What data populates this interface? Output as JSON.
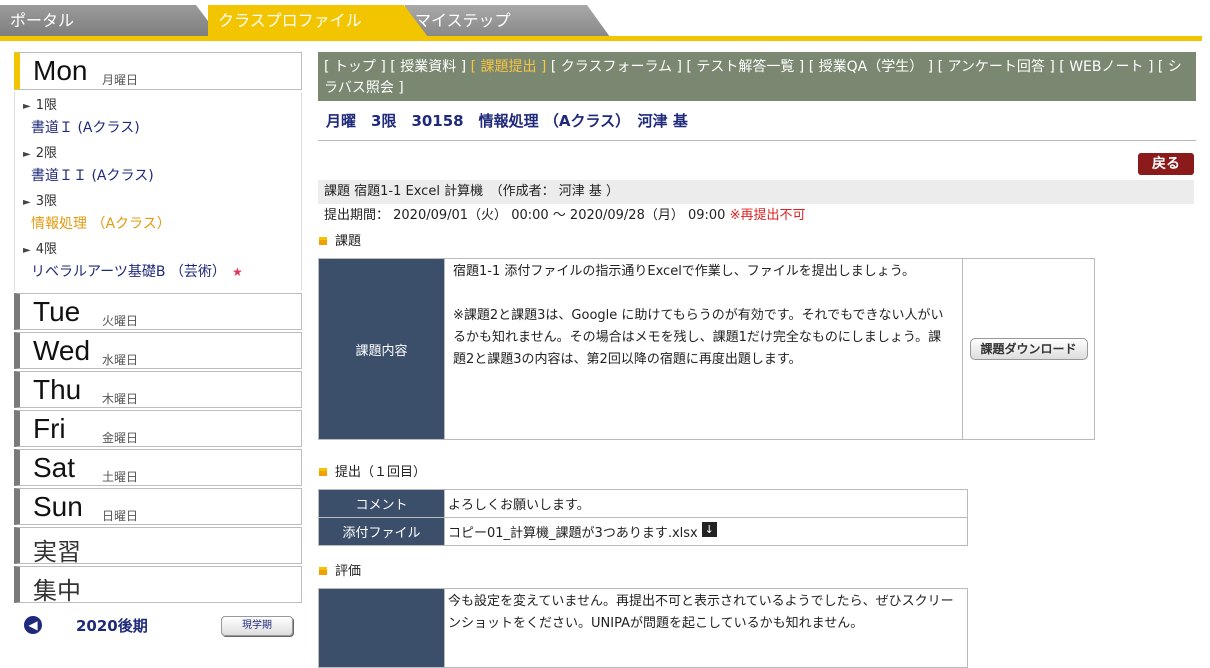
{
  "tabs": {
    "portal": "ポータル",
    "class_profile": "クラスプロファイル",
    "my_step": "マイステップ"
  },
  "sidebar": {
    "days": [
      {
        "en": "Mon",
        "jp": "月曜日"
      },
      {
        "en": "Tue",
        "jp": "火曜日"
      },
      {
        "en": "Wed",
        "jp": "水曜日"
      },
      {
        "en": "Thu",
        "jp": "木曜日"
      },
      {
        "en": "Fri",
        "jp": "金曜日"
      },
      {
        "en": "Sat",
        "jp": "土曜日"
      },
      {
        "en": "Sun",
        "jp": "日曜日"
      }
    ],
    "monday_periods": [
      {
        "period": "1限",
        "course": "書道Ｉ (Aクラス)"
      },
      {
        "period": "2限",
        "course": "書道ＩＩ (Aクラス)"
      },
      {
        "period": "3限",
        "course": "情報処理 （Aクラス）"
      },
      {
        "period": "4限",
        "course": "リベラルアーツ基礎B （芸術）"
      }
    ],
    "practicum": "実習",
    "intensive": "集中",
    "term_label": "2020後期",
    "current_term_button": "現学期"
  },
  "nav": {
    "top": "[ トップ ]",
    "materials": "[ 授業資料 ]",
    "submission": "[ 課題提出 ]",
    "forum": "[ クラスフォーラム ]",
    "test_answers": "[ テスト解答一覧 ]",
    "qa": "[ 授業QA（学生） ]",
    "survey": "[ アンケート回答 ]",
    "webnote": "[ WEBノート ]",
    "syllabus": "[ シラバス照会 ]"
  },
  "course_title": "月曜　3限　30158　情報処理 （Aクラス）　河津 基",
  "back_button": "戻る",
  "assignment": {
    "title": "課題 宿題1-1 Excel 計算機　（作成者： 河津 基 ）",
    "period": "提出期間： 2020/09/01（火） 00:00 ～ 2020/09/28（月） 09:00",
    "resubmit_note": "※再提出不可"
  },
  "section_task": "課題",
  "task": {
    "label": "課題内容",
    "line1": "宿題1-1 添付ファイルの指示通りExcelで作業し、ファイルを提出しましょう。",
    "line2": "※課題2と課題3は、Google に助けてもらうのが有効です。それでもできない人がいるかも知れません。その場合はメモを残し、課題1だけ完全なものにしましょう。課題2と課題3の内容は、第2回以降の宿題に再度出題します。",
    "download_button": "課題ダウンロード"
  },
  "section_submission": "提出（１回目）",
  "submission": {
    "comment_label": "コメント",
    "comment": "よろしくお願いします。",
    "file_label": "添付ファイル",
    "file": "コピー01_計算機_課題が3つあります.xlsx"
  },
  "section_eval": "評価",
  "evaluation": {
    "text": "今も設定を変えていません。再提出不可と表示されているようでしたら、ぜひスクリーンショットをください。UNIPAが問題を起こしているかも知れません。"
  }
}
